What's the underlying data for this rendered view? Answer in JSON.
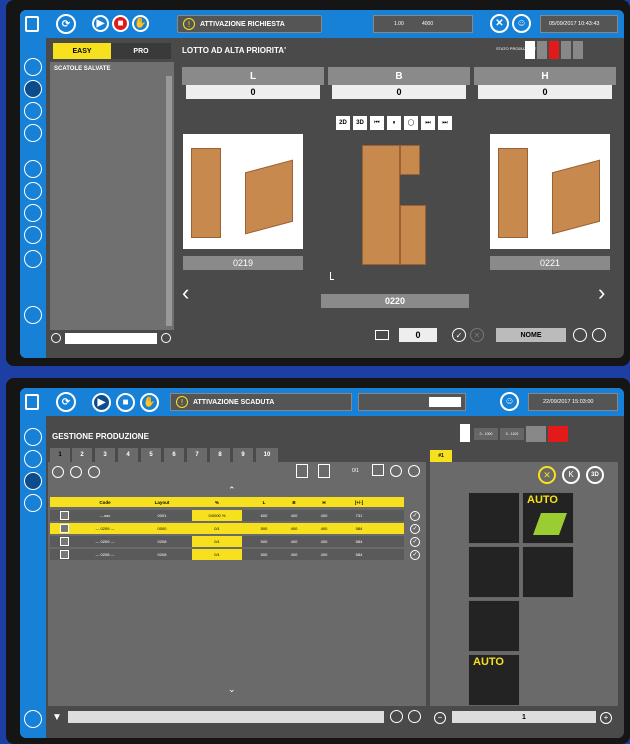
{
  "top": {
    "alarm": "ATTIVAZIONE RICHIESTA",
    "datetime": "05/09/2017 10:43:43",
    "count_a": "1.00",
    "count_b": "4000",
    "tab_easy": "EASY",
    "tab_pro": "PRO",
    "saved_boxes": "SCATOLE SALVATE",
    "section_title": "LOTTO AD ALTA PRIORITA'",
    "status_label": "STATO PRODUZIONE",
    "dims": [
      {
        "label": "L",
        "value": "0"
      },
      {
        "label": "B",
        "value": "0"
      },
      {
        "label": "H",
        "value": "0"
      }
    ],
    "view_buttons": [
      "2D",
      "3D",
      "⏮",
      "⏸",
      "◯",
      "⏭",
      "⏭"
    ],
    "prev_id": "0219",
    "current_id": "0220",
    "next_id": "0221",
    "qty": "0",
    "name_label": "NOME"
  },
  "bottom": {
    "alarm": "ATTIVAZIONE SCADUTA",
    "datetime": "22/09/2017 15:03:00",
    "section_title": "GESTIONE PRODUZIONE",
    "tabs": [
      "1",
      "2",
      "3",
      "4",
      "5",
      "6",
      "7",
      "8",
      "9",
      "10"
    ],
    "badge": "#1",
    "fraction": "0/1",
    "table_headers": [
      "Code",
      "Layout",
      "%",
      "L",
      "B",
      "H",
      "[+/-]"
    ],
    "rows": [
      [
        "---nav",
        "0001",
        "0/0000 %",
        "600",
        "400",
        "400",
        "731"
      ],
      [
        "--- 0209 ---",
        "0000",
        "0/1",
        "500",
        "400",
        "400",
        "584"
      ],
      [
        "--- 0209 ---",
        "0208",
        "0/1",
        "500",
        "400",
        "400",
        "584"
      ],
      [
        "--- 0208 ---",
        "0208",
        "0/1",
        "500",
        "400",
        "400",
        "584"
      ]
    ],
    "auto_label_1": "AUTO",
    "auto_label_2": "AUTO",
    "temp_a": "0 - 1000",
    "temp_b": "0 - 1100",
    "bottom_value": "1"
  },
  "colors": {
    "accent": "#1681d6",
    "highlight": "#f7e11e",
    "alarm_red": "#e21a1a"
  }
}
